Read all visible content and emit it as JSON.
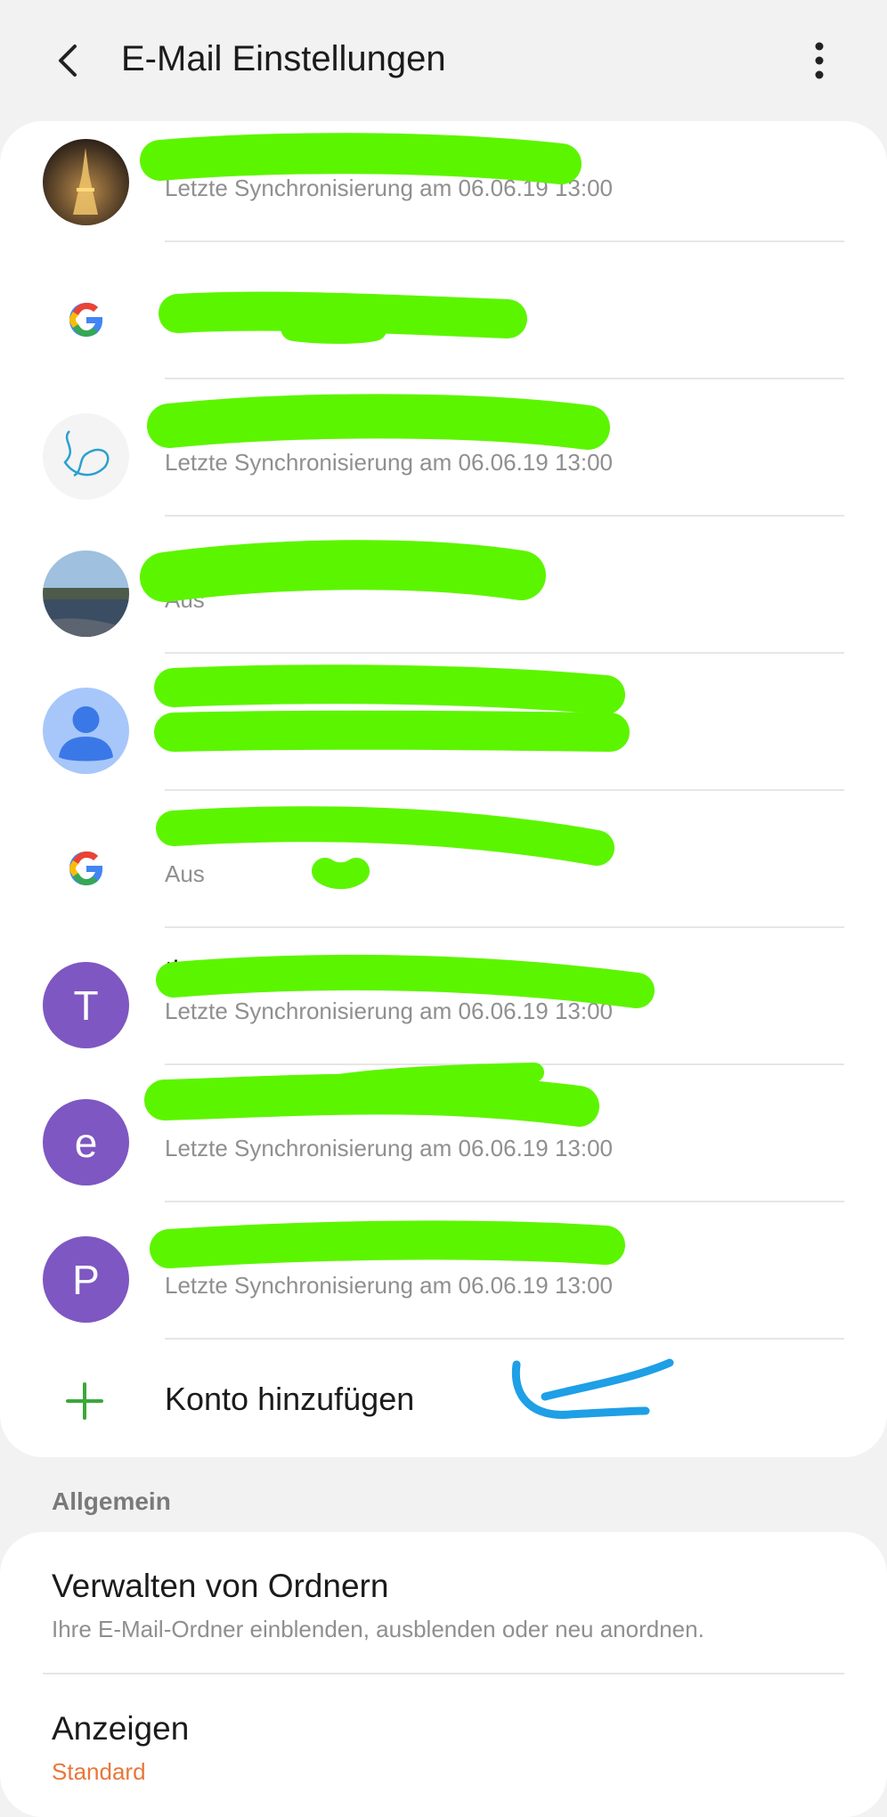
{
  "header": {
    "title": "E-Mail Einstellungen",
    "back_icon": "back-arrow-icon",
    "more_icon": "more-vert-icon"
  },
  "accounts": [
    {
      "avatar": "eiffel-tower-photo",
      "name": "",
      "status": "Letzte Synchronisierung am 06.06.19  13:00"
    },
    {
      "avatar": "google-icon",
      "name": "",
      "status": ""
    },
    {
      "avatar": "sketch-photo",
      "name": "",
      "status": "Letzte Synchronisierung am 06.06.19  13:00"
    },
    {
      "avatar": "lake-photo",
      "name": "",
      "status": "Aus"
    },
    {
      "avatar": "default-person-icon",
      "name": "",
      "status": ""
    },
    {
      "avatar": "google-icon",
      "name": "",
      "status": "Aus"
    },
    {
      "avatar": "letter",
      "letter": "T",
      "name": "the",
      "status": "Letzte Synchronisierung am 06.06.19  13:00"
    },
    {
      "avatar": "letter",
      "letter": "e",
      "name": "",
      "status": "Letzte Synchronisierung am 06.06.19  13:00"
    },
    {
      "avatar": "letter",
      "letter": "P",
      "name": "",
      "status": "Letzte Synchronisierung am 06.06.19  13:00"
    }
  ],
  "add_account": {
    "label": "Konto hinzufügen",
    "icon": "plus-icon"
  },
  "general": {
    "section_label": "Allgemein",
    "folders": {
      "title": "Verwalten von Ordnern",
      "subtitle": "Ihre E-Mail-Ordner einblenden, ausblenden oder neu anordnen."
    },
    "display": {
      "title": "Anzeigen",
      "value": "Standard"
    }
  },
  "colors": {
    "scribble": "#5cf500",
    "annotation": "#1e9fe6",
    "accent_orange": "#e8773a",
    "add_green": "#3aa83a",
    "letter_avatar": "#7e57c2"
  }
}
